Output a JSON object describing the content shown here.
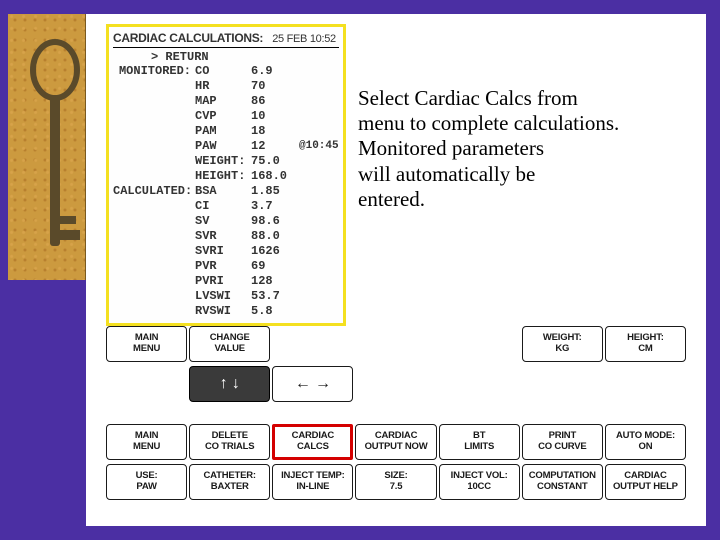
{
  "panel": {
    "title": "CARDIAC CALCULATIONS:",
    "timestamp": "25 FEB 10:52",
    "return": "> RETURN",
    "section_monitored": "MONITORED:",
    "section_calculated": "CALCULATED:",
    "note_time": "@10:45",
    "monitored": [
      {
        "par": "CO",
        "val": "6.9"
      },
      {
        "par": "HR",
        "val": "70"
      },
      {
        "par": "MAP",
        "val": "86"
      },
      {
        "par": "CVP",
        "val": "10"
      },
      {
        "par": "PAM",
        "val": "18"
      },
      {
        "par": "PAW",
        "val": "12"
      },
      {
        "par": "WEIGHT:",
        "val": "75.0"
      },
      {
        "par": "HEIGHT:",
        "val": "168.0"
      }
    ],
    "calculated": [
      {
        "par": "BSA",
        "val": "1.85"
      },
      {
        "par": "CI",
        "val": "3.7"
      },
      {
        "par": "SV",
        "val": "98.6"
      },
      {
        "par": "SVR",
        "val": "88.0"
      },
      {
        "par": "SVRI",
        "val": "1626"
      },
      {
        "par": "PVR",
        "val": "69"
      },
      {
        "par": "PVRI",
        "val": "128"
      },
      {
        "par": "LVSWI",
        "val": "53.7"
      },
      {
        "par": "RVSWI",
        "val": "5.8"
      }
    ]
  },
  "instruction": {
    "l1": "Select Cardiac Calcs from",
    "l2": "menu to complete calculations.",
    "l3": "Monitored parameters",
    "l4": "will automatically be",
    "l5": "entered."
  },
  "row1": {
    "b0a": "MAIN",
    "b0b": "MENU",
    "b1a": "CHANGE",
    "b1b": "VALUE",
    "b5a": "WEIGHT:",
    "b5b": "KG",
    "b6a": "HEIGHT:",
    "b6b": "CM"
  },
  "row2": {
    "b1": "↑  ↓",
    "b2": "←  →"
  },
  "row3": {
    "b0a": "MAIN",
    "b0b": "MENU",
    "b1a": "DELETE",
    "b1b": "CO TRIALS",
    "b2a": "CARDIAC",
    "b2b": "CALCS",
    "b3a": "CARDIAC",
    "b3b": "OUTPUT NOW",
    "b4a": "BT",
    "b4b": "LIMITS",
    "b5a": "PRINT",
    "b5b": "CO CURVE",
    "b6a": "AUTO MODE:",
    "b6b": "ON"
  },
  "row4": {
    "b0a": "USE:",
    "b0b": "PAW",
    "b1a": "CATHETER:",
    "b1b": "BAXTER",
    "b2a": "INJECT TEMP:",
    "b2b": "IN-LINE",
    "b3a": "SIZE:",
    "b3b": "7.5",
    "b4a": "INJECT VOL:",
    "b4b": "10CC",
    "b5a": "COMPUTATION",
    "b5b": "CONSTANT",
    "b6a": "CARDIAC",
    "b6b": "OUTPUT HELP"
  }
}
